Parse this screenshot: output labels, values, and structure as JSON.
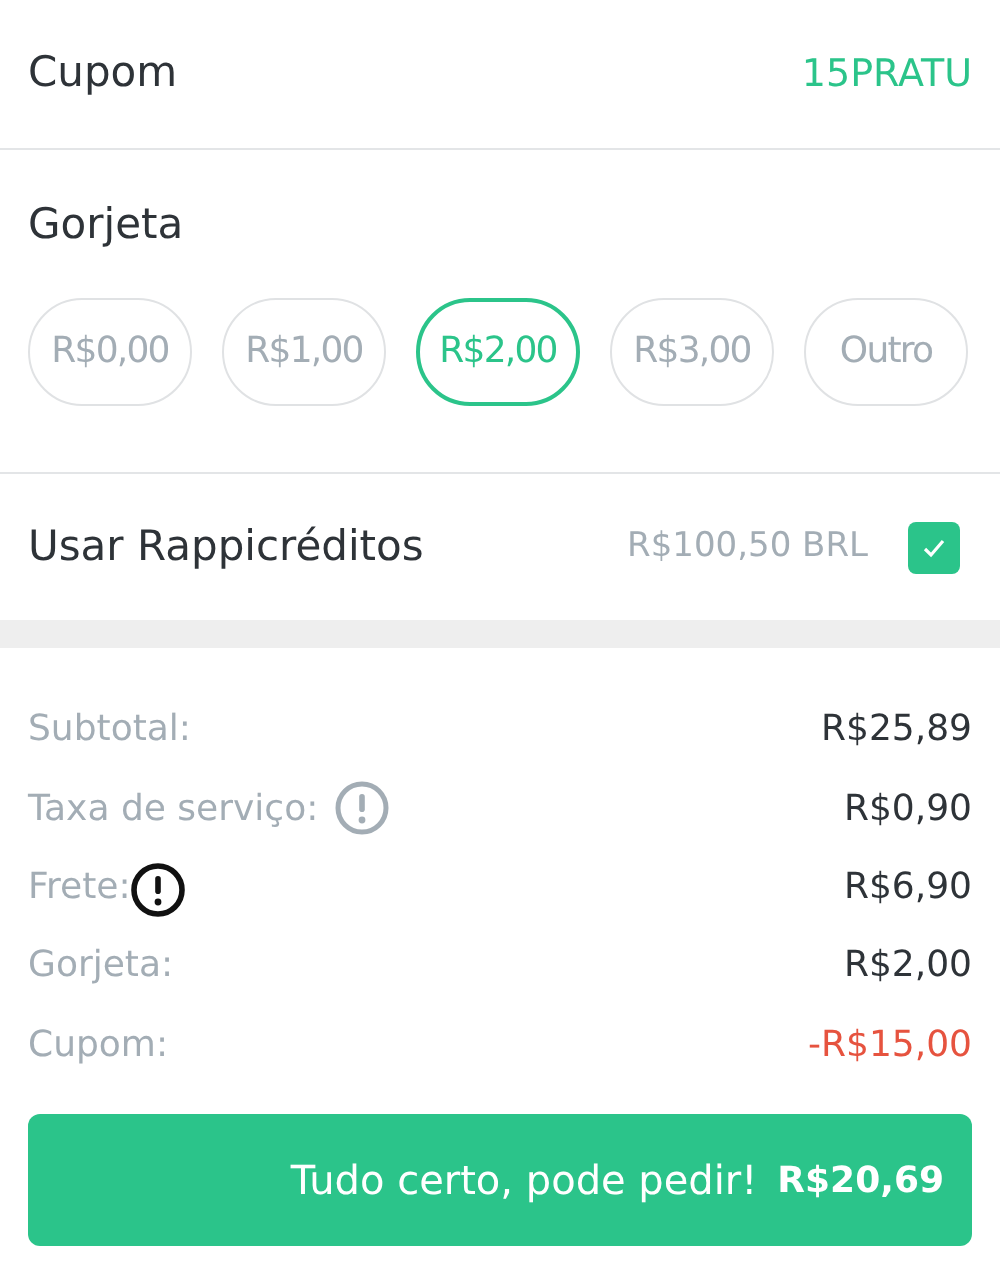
{
  "coupon": {
    "label": "Cupom",
    "code": "15PRATU"
  },
  "tip": {
    "title": "Gorjeta",
    "options": [
      {
        "label": "R$0,00",
        "selected": false
      },
      {
        "label": "R$1,00",
        "selected": false
      },
      {
        "label": "R$2,00",
        "selected": true
      },
      {
        "label": "R$3,00",
        "selected": false
      },
      {
        "label": "Outro",
        "selected": false
      }
    ]
  },
  "credits": {
    "label": "Usar Rappicréditos",
    "amount": "R$100,50 BRL",
    "checked": true
  },
  "summary": [
    {
      "label": "Subtotal:",
      "value": "R$25,89",
      "kind": "plain",
      "negative": false
    },
    {
      "label": "Taxa de serviço:",
      "value": "R$0,90",
      "kind": "info",
      "negative": false
    },
    {
      "label": "Frete:",
      "value": "R$6,90",
      "kind": "info-dark",
      "negative": false
    },
    {
      "label": "Gorjeta:",
      "value": "R$2,00",
      "kind": "plain",
      "negative": false
    },
    {
      "label": "Cupom:",
      "value": "-R$15,00",
      "kind": "plain",
      "negative": true
    }
  ],
  "submit": {
    "label": "Tudo certo, pode pedir!",
    "total": "R$20,69"
  }
}
